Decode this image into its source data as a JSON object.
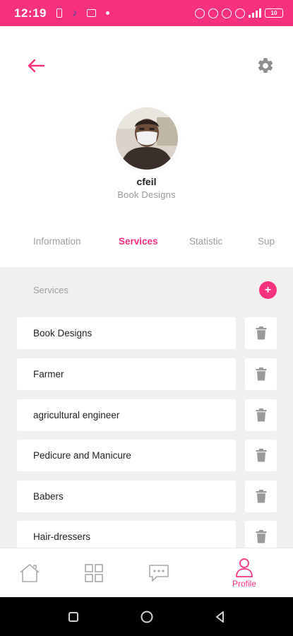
{
  "status_bar": {
    "time": "12:19",
    "battery": "10"
  },
  "profile": {
    "name": "cfeil",
    "subtitle": "Book Designs"
  },
  "tabs": [
    {
      "label": "Information",
      "active": false
    },
    {
      "label": "Services",
      "active": true
    },
    {
      "label": "Statistic",
      "active": false
    },
    {
      "label": "Supp",
      "active": false
    }
  ],
  "services": {
    "heading": "Services",
    "add_label": "+",
    "items": [
      {
        "label": "Book Designs"
      },
      {
        "label": "Farmer"
      },
      {
        "label": "agricultural engineer"
      },
      {
        "label": "Pedicure and Manicure"
      },
      {
        "label": "Babers"
      },
      {
        "label": "Hair-dressers"
      }
    ]
  },
  "bottom_nav": {
    "items": [
      {
        "icon": "home-icon",
        "label": ""
      },
      {
        "icon": "grid-icon",
        "label": ""
      },
      {
        "icon": "chat-icon",
        "label": ""
      },
      {
        "icon": "profile-icon",
        "label": "Profile",
        "active": true
      }
    ]
  },
  "colors": {
    "accent": "#f8317e",
    "muted_text": "#9e9e9e",
    "section_bg": "#f0f0f0"
  }
}
